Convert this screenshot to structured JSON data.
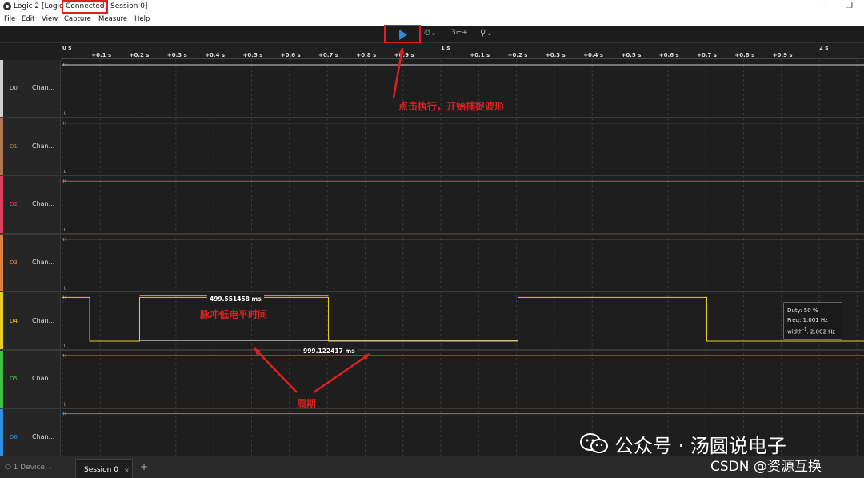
{
  "window": {
    "title_prefix": "Logic 2 [Logic",
    "title_connected": "Connected]",
    "title_suffix": "Session 0]",
    "min_icon": "—",
    "restore_icon": "❐"
  },
  "menu": [
    "File",
    "Edit",
    "View",
    "Capture",
    "Measure",
    "Help"
  ],
  "toolbar": {
    "play_icon": "play-icon",
    "trigger_count": "3"
  },
  "ruler": {
    "major_labels": [
      {
        "text": "0 s",
        "t": 0.0
      },
      {
        "text": "1 s",
        "t": 1.0
      },
      {
        "text": "2 s",
        "t": 2.0
      }
    ],
    "minor_labels": [
      {
        "text": "+0.1 s",
        "t": 0.1
      },
      {
        "text": "+0.2 s",
        "t": 0.2
      },
      {
        "text": "+0.3 s",
        "t": 0.3
      },
      {
        "text": "+0.4 s",
        "t": 0.4
      },
      {
        "text": "+0.5 s",
        "t": 0.5
      },
      {
        "text": "+0.6 s",
        "t": 0.6
      },
      {
        "text": "+0.7 s",
        "t": 0.7
      },
      {
        "text": "+0.8 s",
        "t": 0.8
      },
      {
        "text": "+0.9 s",
        "t": 0.9
      },
      {
        "text": "+0.1 s",
        "t": 1.1
      },
      {
        "text": "+0.2 s",
        "t": 1.2
      },
      {
        "text": "+0.3 s",
        "t": 1.3
      },
      {
        "text": "+0.4 s",
        "t": 1.4
      },
      {
        "text": "+0.5 s",
        "t": 1.5
      },
      {
        "text": "+0.6 s",
        "t": 1.6
      },
      {
        "text": "+0.7 s",
        "t": 1.7
      },
      {
        "text": "+0.8 s",
        "t": 1.8
      },
      {
        "text": "+0.9 s",
        "t": 1.9
      }
    ]
  },
  "channels": [
    {
      "id": "D0",
      "name": "Chan...",
      "color": "#d0d0d0",
      "high_label": "H",
      "low_label": "L"
    },
    {
      "id": "D1",
      "name": "Chan...",
      "color": "#b07850",
      "high_label": "H",
      "low_label": "L"
    },
    {
      "id": "D2",
      "name": "Chan...",
      "color": "#e04060",
      "high_label": "H",
      "low_label": "L"
    },
    {
      "id": "D3",
      "name": "Chan...",
      "color": "#e08040",
      "high_label": "H",
      "low_label": "L"
    },
    {
      "id": "D4",
      "name": "Chan...",
      "color": "#e8d020",
      "high_label": "H",
      "low_label": "L"
    },
    {
      "id": "D5",
      "name": "Chan...",
      "color": "#40c040",
      "high_label": "H",
      "low_label": "L"
    },
    {
      "id": "D6",
      "name": "Chan...",
      "color": "#3090e0",
      "high_label": "H",
      "low_label": "L"
    }
  ],
  "d4_waveform": {
    "edges_s": [
      0.0,
      0.072,
      0.204,
      0.703,
      1.204,
      1.703
    ],
    "start_level": "high",
    "end_s": 2.1
  },
  "measurements": {
    "low_width": "499.551458 ms",
    "period": "999.122417 ms",
    "duty": "Duty: 50 %",
    "freq": "Freq: 1.001 Hz",
    "width_inv_prefix": "width",
    "width_inv_sup": "-1",
    "width_inv_value": ": 2.002 Hz"
  },
  "annotations": {
    "start_capture": "点击执行，开始捕捉波形",
    "pulse_low_time": "脉冲低电平时间",
    "period": "周期"
  },
  "tabs": {
    "device": "1 Device",
    "session": "Session 0",
    "close": "×",
    "add": "+"
  },
  "watermarks": {
    "wechat": "公众号 · 汤圆说电子",
    "csdn": "CSDN @资源互换"
  }
}
